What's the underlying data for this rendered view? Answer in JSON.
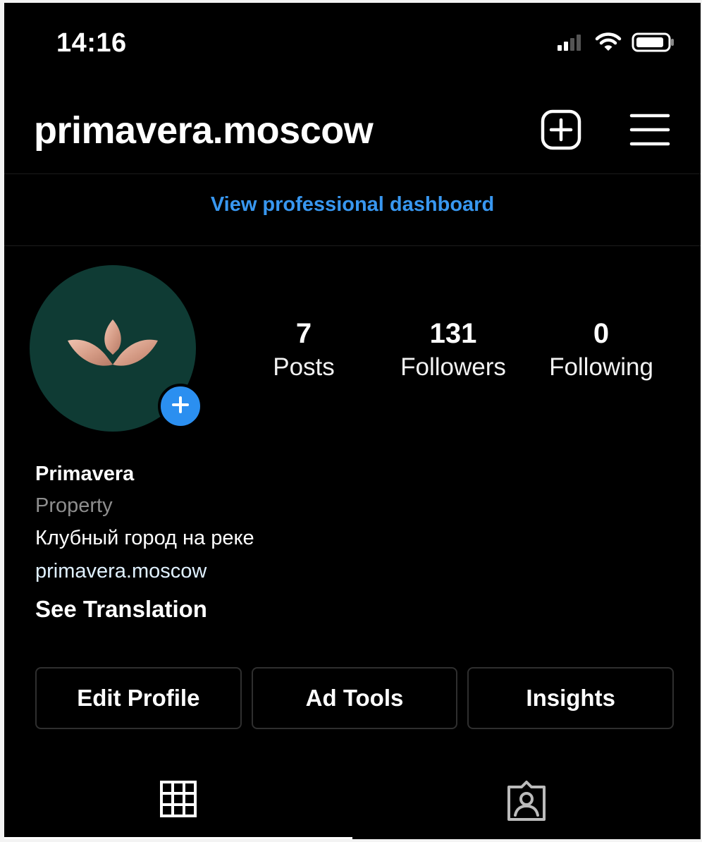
{
  "status_bar": {
    "time": "14:16",
    "signal_icon": "cellular-signal-icon",
    "wifi_icon": "wifi-icon",
    "battery_icon": "battery-icon"
  },
  "header": {
    "username": "primavera.moscow",
    "create_icon": "plus-square-icon",
    "menu_icon": "hamburger-menu-icon"
  },
  "dashboard": {
    "link_label": "View professional dashboard"
  },
  "profile": {
    "avatar_icon": "lotus-logo",
    "avatar_color": "#0f3b34",
    "add_story_icon": "plus-icon",
    "stats": [
      {
        "value": "7",
        "label": "Posts"
      },
      {
        "value": "131",
        "label": "Followers"
      },
      {
        "value": "0",
        "label": "Following"
      }
    ]
  },
  "bio": {
    "name": "Primavera",
    "category": "Property",
    "text": "Клубный город на реке",
    "link": "primavera.moscow",
    "translation_label": "See Translation"
  },
  "actions": [
    {
      "label": "Edit Profile"
    },
    {
      "label": "Ad Tools"
    },
    {
      "label": "Insights"
    }
  ],
  "tabs": [
    {
      "icon": "grid-icon",
      "selected": true
    },
    {
      "icon": "tagged-person-icon",
      "selected": false
    }
  ],
  "colors": {
    "background": "#000000",
    "link_blue": "#3897f0",
    "secondary_text": "#8e8e8e",
    "button_border": "#2f2f2f"
  }
}
